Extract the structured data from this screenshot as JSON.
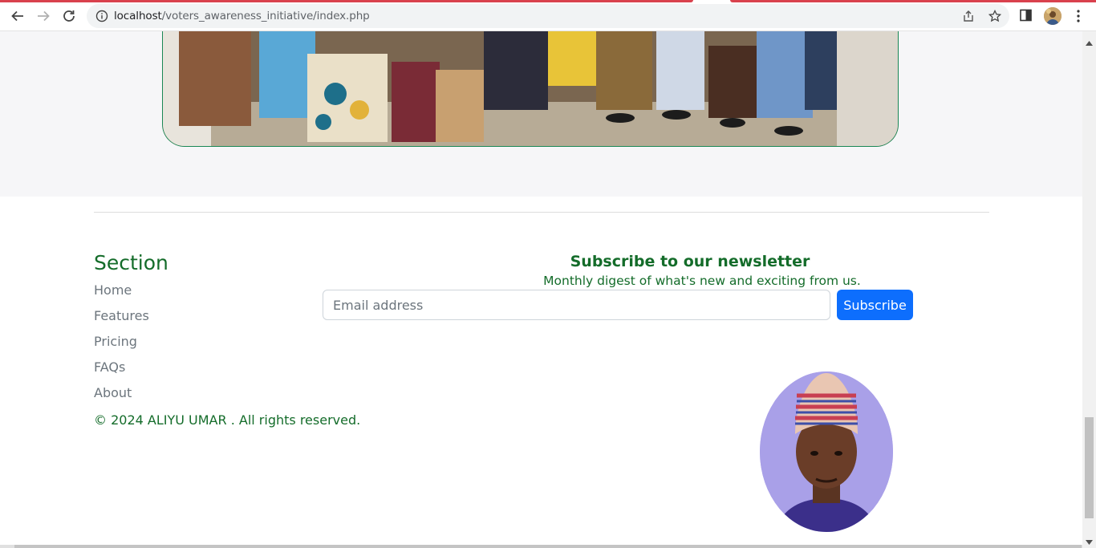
{
  "browser": {
    "url_host": "localhost",
    "url_path": "/voters_awareness_initiative/index.php",
    "icons": [
      "back-icon",
      "forward-icon",
      "reload-icon",
      "info-icon",
      "share-icon",
      "star-icon",
      "side-panel-icon",
      "avatar",
      "menu-icon"
    ]
  },
  "footer": {
    "section_title": "Section",
    "nav_items": [
      "Home",
      "Features",
      "Pricing",
      "FAQs",
      "About"
    ],
    "copyright": "© 2024 ALIYU UMAR . All rights reserved."
  },
  "newsletter": {
    "title": "Subscribe to our newsletter",
    "subtitle": "Monthly digest of what's new and exciting from us.",
    "email_placeholder": "Email address",
    "button_label": "Subscribe"
  },
  "colors": {
    "brand_green": "#146c2a",
    "primary_blue": "#0d6efd",
    "tab_red": "#d9414d"
  }
}
